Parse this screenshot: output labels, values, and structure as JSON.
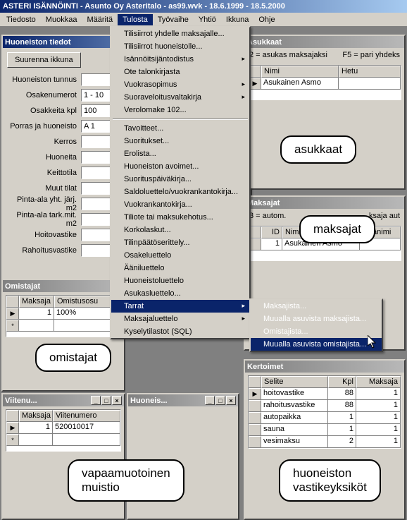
{
  "title": "ASTERI ISÄNNÖINTI - Asunto Oy Asteritalo - as99.wvk - 18.6.1999 - 18.5.2000",
  "menubar": [
    "Tiedosto",
    "Muokkaa",
    "Määritä",
    "Tulosta",
    "Työvaihe",
    "Yhtiö",
    "Ikkuna",
    "Ohje"
  ],
  "menu_open_index": 3,
  "tulosta_menu": [
    "Tilisiirrot yhdelle maksajalle...",
    "Tilisiirrot huoneistolle...",
    "Isännöitsijäntodistus",
    "Ote talonkirjasta",
    "Vuokrasopimus",
    "Suoraveloitusvaltakirja",
    "Verolomake 102...",
    "-",
    "Tavoitteet...",
    "Suoritukset...",
    "Erolista...",
    "Huoneiston avoimet...",
    "Suorituspäiväkirja...",
    "Saldoluettelo/vuokrankantokirja...",
    "Vuokrankantokirja...",
    "Tiliote tai maksukehotus...",
    "Korkolaskut...",
    "Tilinpäätöserittely...",
    "Osakeluettelo",
    "Ääniluettelo",
    "Huoneistoluettelo",
    "Asukasluettelo...",
    "Tarrat",
    "Maksajaluettelo",
    "Kyselytilastot (SQL)"
  ],
  "tulosta_sub_index": [
    2,
    4,
    5,
    22,
    23
  ],
  "tulosta_hl": 22,
  "tarrat_submenu": [
    "Maksajista...",
    "Muualla asuvista maksajista...",
    "Omistajista...",
    "Muualla asuvista omistajista..."
  ],
  "tarrat_hl": 3,
  "huoneisto": {
    "title": "Huoneiston tiedot",
    "btn": "Suurenna ikkuna",
    "fields": {
      "tunnus": "Huoneiston tunnus",
      "osakenum": "Osakenumerot",
      "osakenum_v": "1 - 10",
      "osakkeita": "Osakkeita kpl",
      "osakkeita_v": "100",
      "porras": "Porras ja huoneisto",
      "porras_v": "A 1",
      "kerros": "Kerros",
      "huoneita": "Huoneita",
      "keitto": "Keittotila",
      "muut": "Muut tilat",
      "pa1": "Pinta-ala yht. järj. m2",
      "pa2": "Pinta-ala tark.mit. m2",
      "hoito": "Hoitovastike",
      "rahoitus": "Rahoitusvastike"
    }
  },
  "omistajat": {
    "title": "Omistajat",
    "cols": [
      "Maksaja",
      "Omistusosu"
    ],
    "row": [
      "1",
      "100%"
    ]
  },
  "viitenu": {
    "title": "Viitenu...",
    "cols": [
      "Maksaja",
      "Viitenumero"
    ],
    "row": [
      "1",
      "520010017"
    ]
  },
  "huoneis2": {
    "title": "Huoneis..."
  },
  "asukkaat": {
    "title": "Asukkaat",
    "hint1": "2 = asukas maksajaksi",
    "hint2": "F5 = pari yhdeks",
    "cols": [
      "Nimi",
      "Hetu"
    ],
    "row": [
      "Asukainen Asmo",
      ""
    ]
  },
  "maksajat": {
    "title": "Maksajat",
    "hint1": "3 = autom.",
    "hint2": "ksaja aut",
    "cols": [
      "ID",
      "Nimi",
      "Lisänimi"
    ],
    "row": [
      "1",
      "Asukainen Asmo",
      ""
    ]
  },
  "kertoimet": {
    "title": "Kertoimet",
    "cols": [
      "Selite",
      "Kpl",
      "Maksaja"
    ],
    "rows": [
      [
        "hoitovastike",
        "88",
        "1"
      ],
      [
        "rahoitusvastike",
        "88",
        "1"
      ],
      [
        "autopaikka",
        "1",
        "1"
      ],
      [
        "sauna",
        "1",
        "1"
      ],
      [
        "vesimaksu",
        "2",
        "1"
      ]
    ]
  },
  "callouts": {
    "asukkaat": "asukkaat",
    "maksajat": "maksajat",
    "omistajat": "omistajat",
    "muistio": "vapaamuotoinen\nmuistio",
    "kertoimet": "huoneiston\nvastikeyksiköt"
  }
}
